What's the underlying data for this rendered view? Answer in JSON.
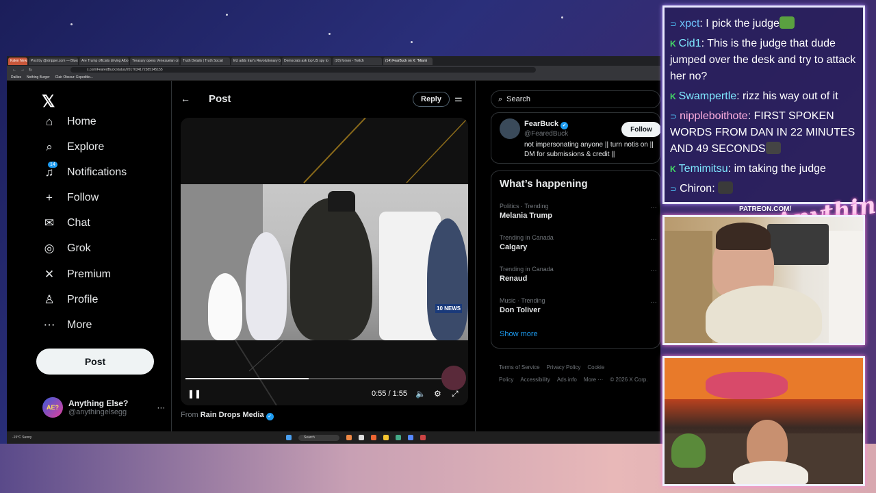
{
  "browser": {
    "tabs": [
      "Kalen News",
      "Post by @stripper.com — Bluesk",
      "Are Trump officials driving Albo",
      "Treasury opens Venezuelan cru",
      "Truth Details | Truth Social",
      "EU adds Iran's Revolutionary G",
      "Democrats ask top US spy to",
      "(20) forsen - Twitch",
      "(14) FearBuck on X: \"Miami"
    ],
    "url": "x.com/FearedBuck/status/2017034172385145155",
    "bookmarks": [
      "Dailies",
      "Nothing Burger",
      "Clair Obscur: Expeditio..."
    ]
  },
  "nav": {
    "items": [
      {
        "label": "Home",
        "icon": "⌂"
      },
      {
        "label": "Explore",
        "icon": "⌕"
      },
      {
        "label": "Notifications",
        "icon": "♫",
        "badge": "14"
      },
      {
        "label": "Follow",
        "icon": "+"
      },
      {
        "label": "Chat",
        "icon": "✉"
      },
      {
        "label": "Grok",
        "icon": "◎"
      },
      {
        "label": "Premium",
        "icon": "✕"
      },
      {
        "label": "Profile",
        "icon": "♙"
      },
      {
        "label": "More",
        "icon": "⋯"
      }
    ],
    "post_label": "Post",
    "profile": {
      "name": "Anything Else?",
      "handle": "@anythingelsegg",
      "avatar_text": "AE?",
      "more": "···"
    }
  },
  "center": {
    "title": "Post",
    "reply_label": "Reply",
    "video": {
      "time": "0:55 / 1:55",
      "progress_fraction": 0.48,
      "watermark": "10 NEWS"
    },
    "from_prefix": "From",
    "from_name": "Rain Drops Media"
  },
  "right": {
    "search_placeholder": "Search",
    "account": {
      "name": "FearBuck",
      "handle": "@FearedBuck",
      "bio": "not impersonating anyone || turn notis on || DM for submissions & credit ||",
      "follow_label": "Follow"
    },
    "trends_title": "What’s happening",
    "trends": [
      {
        "context": "Politics · Trending",
        "name": "Melania Trump"
      },
      {
        "context": "Trending in Canada",
        "name": "Calgary"
      },
      {
        "context": "Trending in Canada",
        "name": "Renaud"
      },
      {
        "context": "Music · Trending",
        "name": "Don Toliver"
      }
    ],
    "show_more": "Show more",
    "footer": [
      "Terms of Service",
      "Privacy Policy",
      "Cookie Policy",
      "Accessibility",
      "Ads info",
      "More ···",
      "© 2026 X Corp."
    ]
  },
  "taskbar": {
    "weather": "-15°C Sunny",
    "search": "Search"
  },
  "chat": [
    {
      "badge": "⊃",
      "badge_type": "twitch",
      "user": "xpct",
      "sep": ":",
      "msg": " I pick the judge",
      "user_class": "blue",
      "emote": "#5aa040"
    },
    {
      "badge": "K",
      "badge_type": "kick",
      "user": "Cid1",
      "sep": ":",
      "msg": " This is the judge that dude jumped over the desk and try to attack her no?",
      "user_class": "cyan"
    },
    {
      "badge": "K",
      "badge_type": "kick",
      "user": "Swampertle",
      "sep": ":",
      "msg": " rizz his way out of it",
      "user_class": "cyan"
    },
    {
      "badge": "⊃",
      "badge_type": "twitch",
      "user": "nippleboithote",
      "sep": ":",
      "msg": " FIRST SPOKEN WORDS FROM DAN IN 22 MINUTES AND 49 SECONDS",
      "user_class": "pink",
      "emote": "#444"
    },
    {
      "badge": "K",
      "badge_type": "kick",
      "user": "Temimitsu",
      "sep": ":",
      "msg": " im taking the judge",
      "user_class": "cyan"
    },
    {
      "badge": "⊃",
      "badge_type": "twitch",
      "user": "Chiron",
      "sep": ":",
      "msg": " ",
      "user_class": "plain",
      "emote": "#3a3a3a"
    }
  ],
  "overlay": {
    "patreon": "PATREON.COM/",
    "logo": "Anything Else?"
  }
}
